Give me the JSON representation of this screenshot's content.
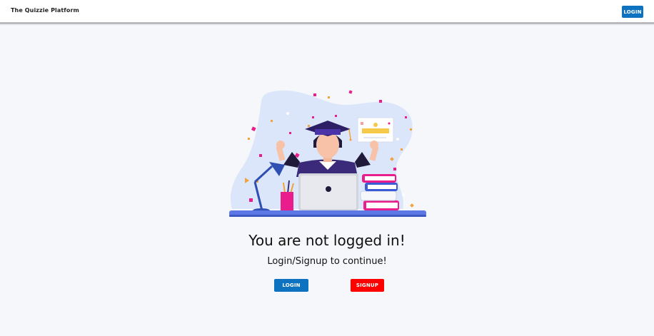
{
  "header": {
    "brand": "The Quizzie Platform",
    "login_label": "LOGIN"
  },
  "main": {
    "illustration": "graduate-at-desk-illustration",
    "title": "You are not logged in!",
    "subtitle": "Login/Signup to continue!",
    "login_label": "LOGIN",
    "signup_label": "SIGNUP"
  },
  "colors": {
    "primary": "#0d72bf",
    "danger": "#ff0000",
    "background": "#f6f7fa"
  }
}
